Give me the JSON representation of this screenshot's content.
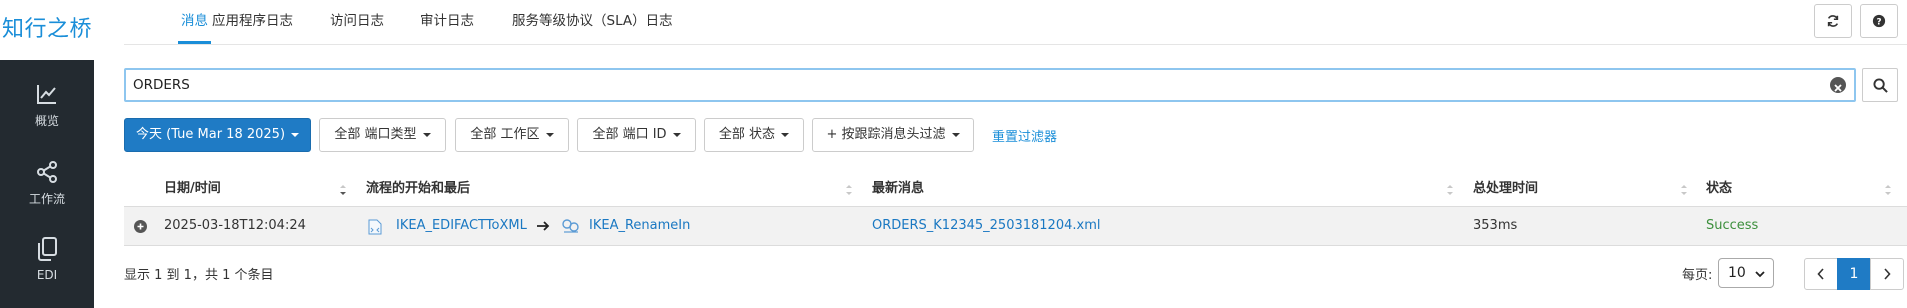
{
  "sidebar": {
    "logo": "知行之桥",
    "items": [
      {
        "label": "概览",
        "icon": "chart-line-icon"
      },
      {
        "label": "工作流",
        "icon": "share-nodes-icon"
      },
      {
        "label": "EDI",
        "icon": "copy-document-icon"
      }
    ]
  },
  "tabs": [
    {
      "label": "消息",
      "active": true
    },
    {
      "label": "应用程序日志"
    },
    {
      "label": "访问日志"
    },
    {
      "label": "审计日志"
    },
    {
      "label": "服务等级协议（SLA）日志"
    }
  ],
  "toolbar": {
    "refresh_icon": "refresh-icon",
    "help_icon": "help-icon"
  },
  "search": {
    "value": "ORDERS"
  },
  "filters": {
    "date": "今天 (Tue Mar 18 2025)",
    "port_type": "全部 端口类型",
    "workspace": "全部 工作区",
    "port_id": "全部 端口 ID",
    "status": "全部 状态",
    "tracked_header": "+ 按跟踪消息头过滤",
    "reset": "重置过滤器"
  },
  "table": {
    "headers": {
      "datetime": "日期/时间",
      "flow": "流程的开始和最后",
      "latest": "最新消息",
      "duration": "总处理时间",
      "status": "状态"
    },
    "rows": [
      {
        "datetime": "2025-03-18T12:04:24",
        "flow_start": "IKEA_EDIFACTToXML",
        "flow_end": "IKEA_RenameIn",
        "latest": "ORDERS_K12345_2503181204.xml",
        "duration": "353ms",
        "status": "Success"
      }
    ]
  },
  "footer": {
    "info": "显示 1 到 1，共 1 个条目",
    "per_page_label": "每页:",
    "per_page": "10",
    "current_page": "1"
  },
  "colors": {
    "accent": "#1a8ed8",
    "primary_button": "#1f7bc5",
    "sidebar": "#232a30",
    "success": "#3c8f3c"
  }
}
